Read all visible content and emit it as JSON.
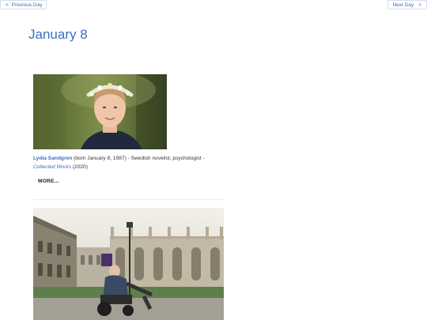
{
  "nav": {
    "prev_icon": "chevron-left-icon",
    "prev_arrow": "<",
    "prev_label": "Previous Day",
    "next_label": "Next Day",
    "next_arrow": ">",
    "next_icon": "chevron-right-icon"
  },
  "page": {
    "title": "January 8"
  },
  "entries": [
    {
      "name": "Lydia Sandgren",
      "description": " (born January 8, 1987) - Swedish novelist, psychologist - ",
      "work": "Collected Works",
      "work_year": " (2020)",
      "more_label": "MORE..."
    }
  ],
  "colors": {
    "accent": "#3a6fc4",
    "text": "#333333",
    "divider": "#eeeeee"
  }
}
